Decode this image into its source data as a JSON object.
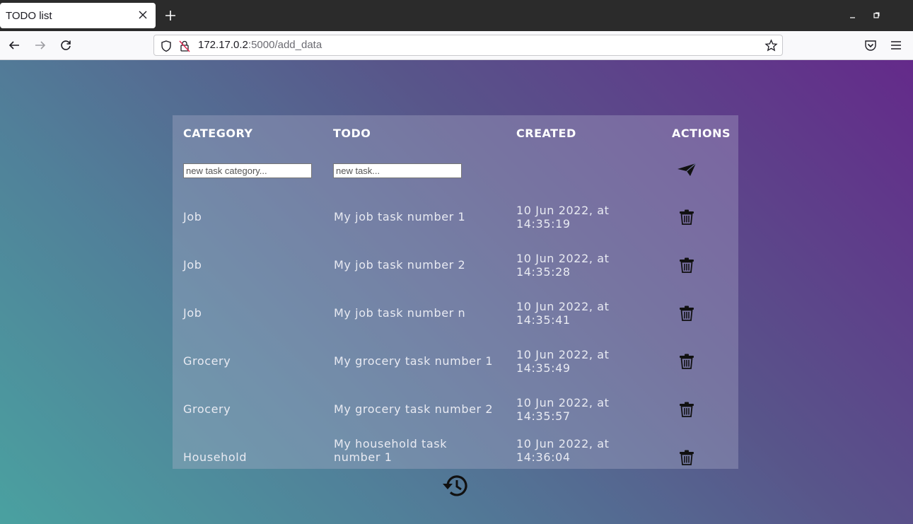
{
  "browser": {
    "tab_title": "TODO list",
    "url_host": "172.17.0.2",
    "url_rest": ":5000/add_data",
    "icons": [
      "close-icon",
      "plus-icon",
      "minimize-icon",
      "maximize-icon",
      "window-close-icon",
      "back-arrow-icon",
      "forward-arrow-icon",
      "reload-icon",
      "shield-icon",
      "insecure-lock-icon",
      "star-icon",
      "pocket-icon",
      "hamburger-menu-icon"
    ]
  },
  "table": {
    "headers": {
      "category": "CATEGORY",
      "todo": "TODO",
      "created": "CREATED",
      "actions": "ACTIONS"
    },
    "new_category_placeholder": "new task category...",
    "new_task_placeholder": "new task...",
    "rows": [
      {
        "category": "Job",
        "todo": "My job task number 1",
        "created": "10 Jun 2022, at 14:35:19"
      },
      {
        "category": "Job",
        "todo": "My job task number 2",
        "created": "10 Jun 2022, at 14:35:28"
      },
      {
        "category": "Job",
        "todo": "My job task number n",
        "created": "10 Jun 2022, at 14:35:41"
      },
      {
        "category": "Grocery",
        "todo": "My grocery task number 1",
        "created": "10 Jun 2022, at 14:35:49"
      },
      {
        "category": "Grocery",
        "todo": "My grocery task number 2",
        "created": "10 Jun 2022, at 14:35:57"
      },
      {
        "category": "Household",
        "todo": "My household task number 1",
        "created": "10 Jun 2022, at 14:36:04"
      }
    ]
  },
  "colors": {
    "gradient_start": "#4aa1a0",
    "gradient_end": "#642a8a",
    "text": "#e8eaf2",
    "header_text": "#ffffff",
    "close_button": "#e95420"
  }
}
